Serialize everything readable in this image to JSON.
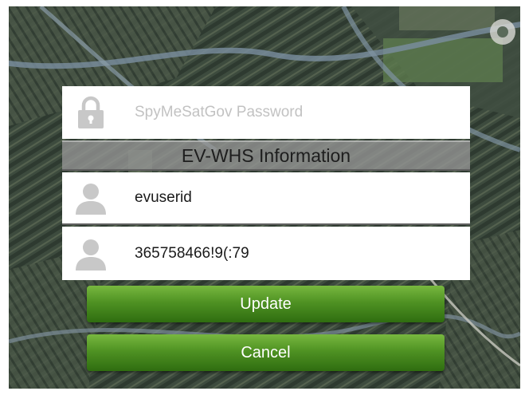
{
  "login": {
    "password_placeholder": "SpyMeSatGov Password",
    "section_title": "EV-WHS Information",
    "userid_value": "evuserid",
    "key_value": "365758466!9(:79"
  },
  "actions": {
    "update_label": "Update",
    "cancel_label": "Cancel"
  },
  "icons": {
    "password": "lock-icon",
    "userid": "user-icon",
    "key": "user-icon"
  },
  "colors": {
    "button_green": "#4f9223",
    "icon_gray": "#c8c8c8",
    "header_gray": "#969696"
  }
}
